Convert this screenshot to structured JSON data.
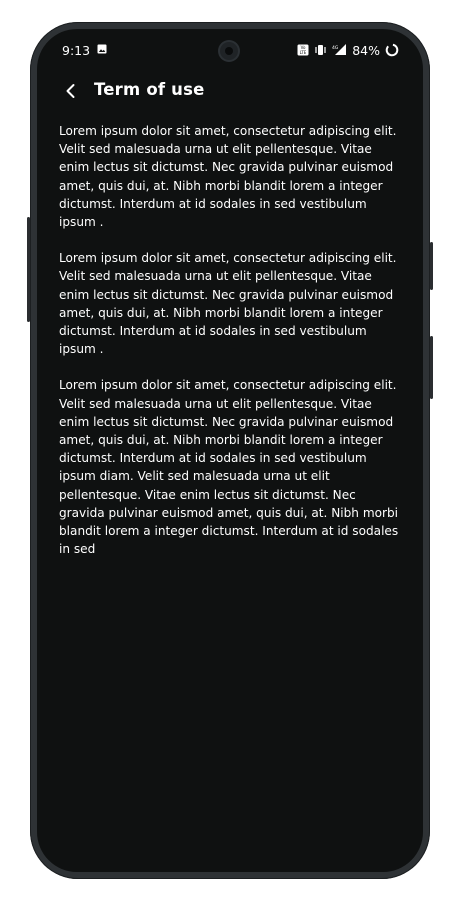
{
  "status_bar": {
    "time": "9:13",
    "battery_percent": "84%",
    "icons": [
      "gallery-icon",
      "volte-icon",
      "vibrate-icon",
      "4g-signal-icon",
      "battery-icon"
    ]
  },
  "app_bar": {
    "back_icon": "chevron-left-icon",
    "title": "Term of use"
  },
  "content": {
    "paragraphs": [
      "Lorem ipsum dolor sit amet, consectetur adipiscing elit. Velit sed malesuada urna ut elit pellentesque. Vitae enim lectus sit dictumst. Nec gravida pulvinar euismod amet, quis dui, at. Nibh morbi blandit lorem a integer dictumst. Interdum at id sodales in sed vestibulum ipsum .",
      "Lorem ipsum dolor sit amet, consectetur adipiscing elit. Velit sed malesuada urna ut elit pellentesque. Vitae enim lectus sit dictumst. Nec gravida pulvinar euismod amet, quis dui, at. Nibh morbi blandit lorem a integer dictumst. Interdum at id sodales in sed vestibulum ipsum .",
      "Lorem ipsum dolor sit amet, consectetur adipiscing elit. Velit sed malesuada urna ut elit pellentesque. Vitae enim lectus sit dictumst. Nec gravida pulvinar euismod amet, quis dui, at. Nibh morbi blandit lorem a integer dictumst. Interdum at id sodales in sed vestibulum ipsum diam. Velit sed malesuada urna ut elit pellentesque. Vitae enim lectus sit dictumst. Nec gravida pulvinar euismod amet, quis dui, at. Nibh morbi blandit lorem a integer dictumst. Interdum at id sodales in sed"
    ]
  },
  "colors": {
    "background": "#0f1111",
    "text": "#ffffff",
    "frame": "#2e3235"
  }
}
